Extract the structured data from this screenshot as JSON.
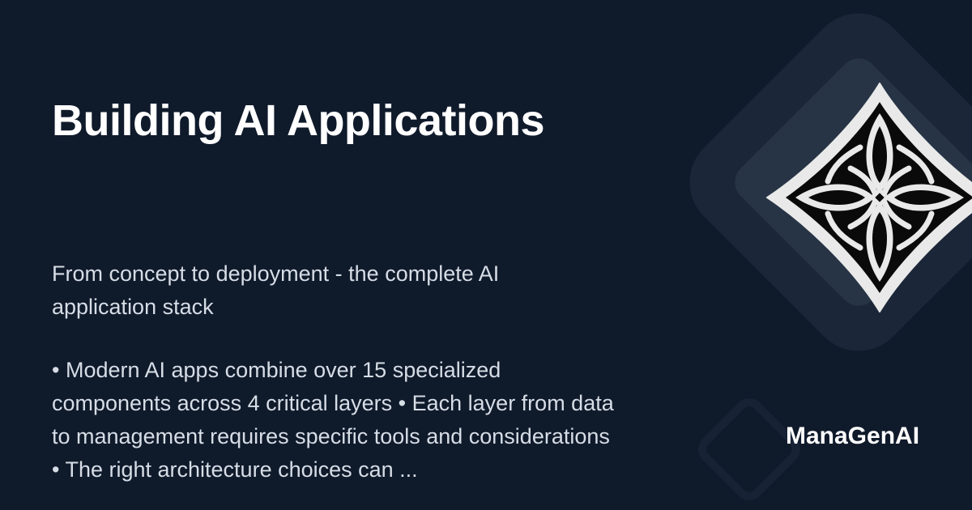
{
  "card": {
    "title": "Building AI Applications",
    "subtitle": "From concept to deployment - the complete AI application stack",
    "body": " • Modern AI apps combine over 15 specialized components across 4 critical layers • Each layer from data to management requires specific tools and considerations • The right architecture choices can ...",
    "brand": "ManaGenAI"
  },
  "icons": [
    "diamond-pattern-logo-icon"
  ],
  "colors": {
    "background": "#0f1a2b",
    "title": "#ffffff",
    "text": "#d7dde6",
    "decor_outer": "#1b2738",
    "decor_inner": "#263445"
  }
}
